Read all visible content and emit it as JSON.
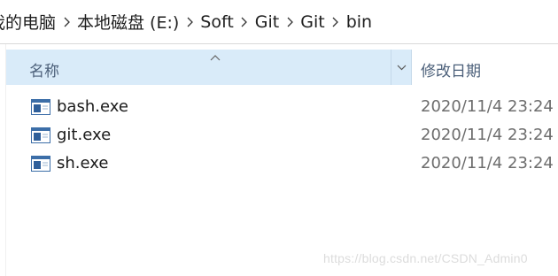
{
  "breadcrumb": {
    "items": [
      "我的电脑",
      "本地磁盘 (E:)",
      "Soft",
      "Git",
      "Git",
      "bin"
    ],
    "separator_icon": "chevron-right-icon"
  },
  "columns": {
    "name_label": "名称",
    "date_label": "修改日期",
    "sort_icon": "sort-ascending-icon",
    "dropdown_icon": "chevron-down-icon",
    "header_bg": "#d9ebf9"
  },
  "files": [
    {
      "name": "bash.exe",
      "modified": "2020/11/4 23:24",
      "icon": "exe-file-icon"
    },
    {
      "name": "git.exe",
      "modified": "2020/11/4 23:24",
      "icon": "exe-file-icon"
    },
    {
      "name": "sh.exe",
      "modified": "2020/11/4 23:24",
      "icon": "exe-file-icon"
    }
  ],
  "watermark": "https://blog.csdn.net/CSDN_Admin0"
}
